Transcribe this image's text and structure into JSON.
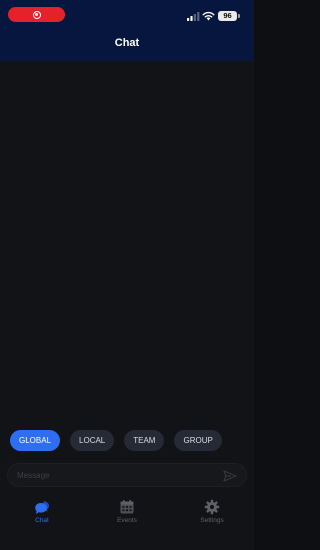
{
  "status_bar": {
    "battery_level": "96",
    "recording": true
  },
  "header": {
    "title": "Chat"
  },
  "channels": {
    "tabs": [
      {
        "label": "GLOBAL",
        "active": true
      },
      {
        "label": "LOCAL",
        "active": false
      },
      {
        "label": "TEAM",
        "active": false
      },
      {
        "label": "GROUP",
        "active": false
      }
    ]
  },
  "composer": {
    "placeholder": "Message",
    "value": "",
    "send_icon": "send-icon"
  },
  "nav": {
    "items": [
      {
        "label": "Chat",
        "icon": "chat-bubbles-icon",
        "active": true
      },
      {
        "label": "Events",
        "icon": "calendar-icon",
        "active": false
      },
      {
        "label": "Settings",
        "icon": "gear-icon",
        "active": false
      }
    ]
  },
  "colors": {
    "header_bg": "#06163f",
    "accent": "#2d6ff0",
    "tab_bg": "#262a35",
    "screen_bg": "#121316",
    "record_red": "#e5212a"
  }
}
